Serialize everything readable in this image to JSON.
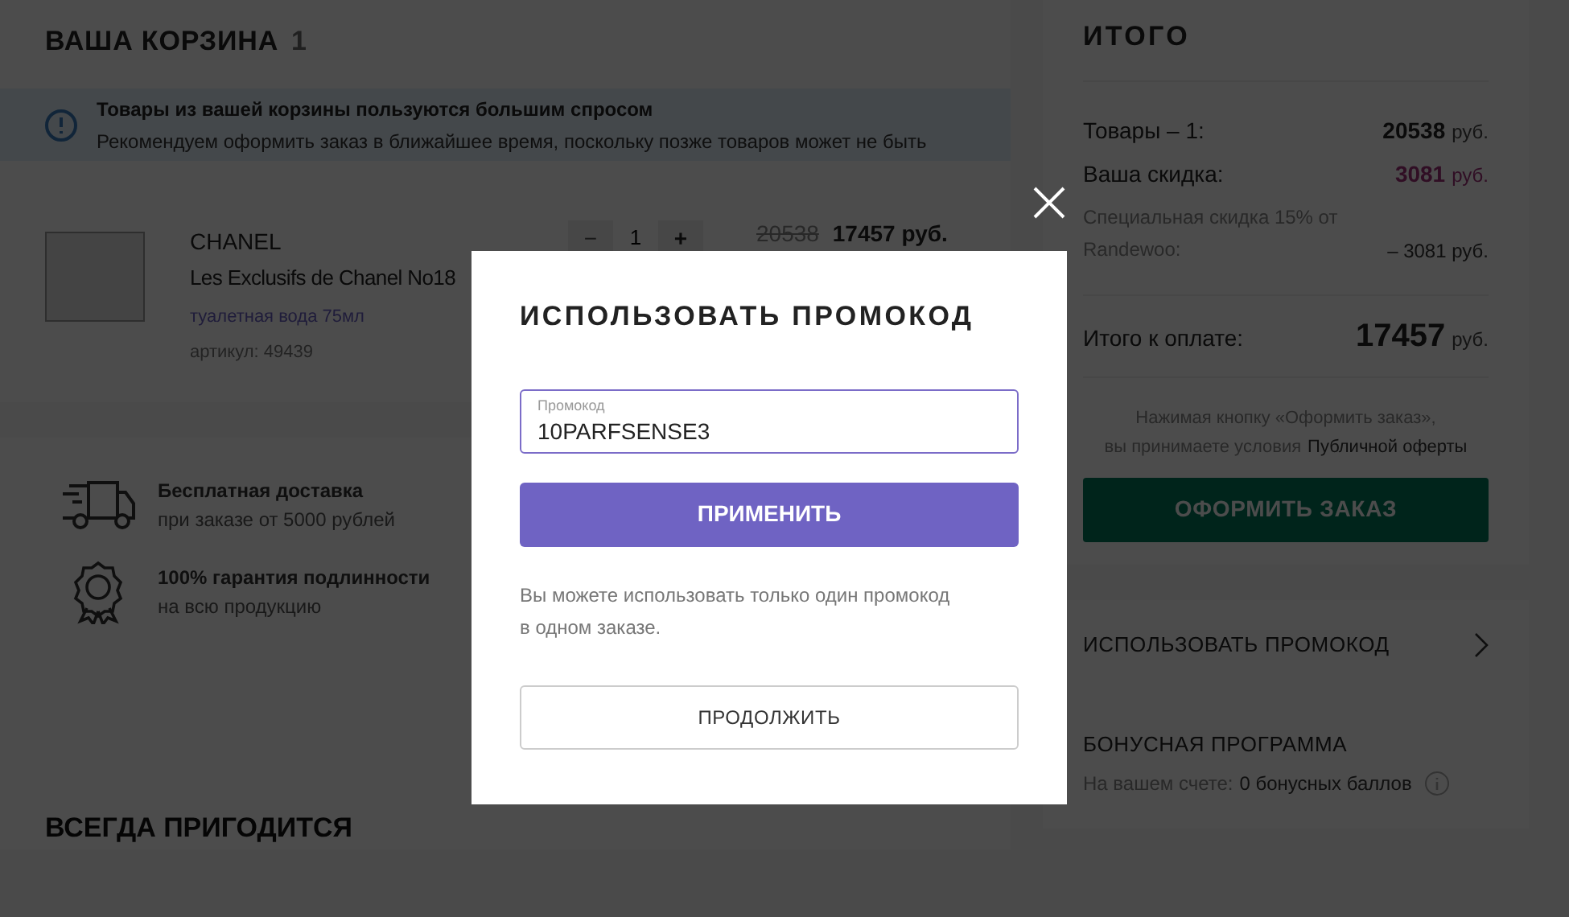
{
  "cart": {
    "title": "ВАША КОРЗИНА",
    "count": "1",
    "notice": {
      "title": "Товары из вашей корзины пользуются большим спросом",
      "text": "Рекомендуем оформить заказ в ближайшее время, поскольку позже товаров может не быть"
    },
    "items": [
      {
        "brand": "CHANEL",
        "name": "Les Exclusifs de Chanel No18",
        "variant": "туалетная вода 75мл",
        "sku": "артикул: 49439",
        "quantity": "1",
        "minus": "−",
        "plus": "+",
        "old_price": "20538",
        "price": "17457 руб."
      }
    ],
    "features": [
      {
        "kind": "delivery",
        "title": "Бесплатная доставка",
        "text": "при заказе от 5000 рублей"
      },
      {
        "kind": "guarantee",
        "title": "100% гарантия подлинности",
        "text": "на всю продукцию"
      }
    ],
    "next_section_title": "ВСЕГДА ПРИГОДИТСЯ"
  },
  "summary": {
    "title": "ИТОГО",
    "lines": [
      {
        "kind": "goods",
        "label": "Товары – 1:",
        "amount": "20538",
        "unit": "руб."
      },
      {
        "kind": "discount",
        "label": "Ваша скидка:",
        "amount": "3081",
        "unit": "руб."
      },
      {
        "kind": "sub",
        "label": "Специальная скидка 15% от Randewoo:",
        "amount": "– 3081 руб."
      }
    ],
    "total": {
      "label": "Итого к оплате:",
      "amount": "17457",
      "unit": "руб."
    },
    "terms": {
      "text": "Нажимая кнопку «Оформить заказ»,",
      "text2": "вы принимаете условия",
      "link": "Публичной оферты"
    },
    "checkout_button": "ОФОРМИТЬ ЗАКАЗ",
    "promo_row": "ИСПОЛЬЗОВАТЬ ПРОМОКОД",
    "bonus": {
      "title": "БОНУСНАЯ ПРОГРАММА",
      "text": "На вашем счете:",
      "value": "0 бонусных баллов"
    }
  },
  "modal": {
    "title": "ИСПОЛЬЗОВАТЬ ПРОМОКОД",
    "field": {
      "label": "Промокод",
      "value": "10PARFSENSE3"
    },
    "apply_button": "ПРИМЕНИТЬ",
    "note": "Вы можете использовать только один промокод в одном заказе.",
    "continue_button": "ПРОДОЛЖИТЬ"
  }
}
